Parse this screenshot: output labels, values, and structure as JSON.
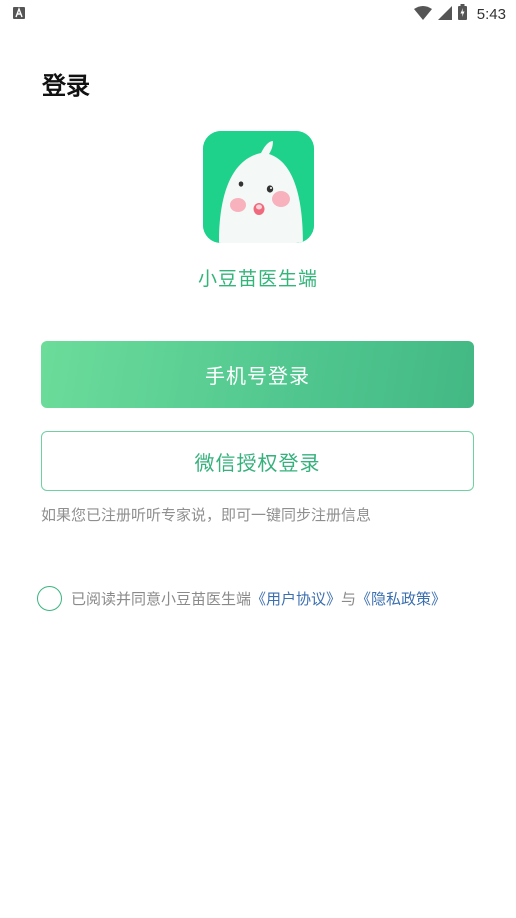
{
  "status_bar": {
    "time": "5:43",
    "icons": [
      "notification-app-icon",
      "wifi-icon",
      "signal-icon",
      "battery-charging-icon"
    ]
  },
  "page": {
    "title": "登录"
  },
  "app": {
    "name": "小豆苗医生端",
    "logo_icon": "mascot-logo-icon",
    "logo_color": "#1ed28b"
  },
  "buttons": {
    "phone_login": "手机号登录",
    "wechat_login": "微信授权登录"
  },
  "hint": "如果您已注册听听专家说，即可一键同步注册信息",
  "agreement": {
    "prefix": "已阅读并同意小豆苗医生端",
    "user_agreement": "《用户协议》",
    "conjunction": "与",
    "privacy_policy": "《隐私政策》",
    "checked": false
  },
  "colors": {
    "accent": "#43b884",
    "link": "#3b6fb0",
    "hint": "#8f8f8f"
  }
}
